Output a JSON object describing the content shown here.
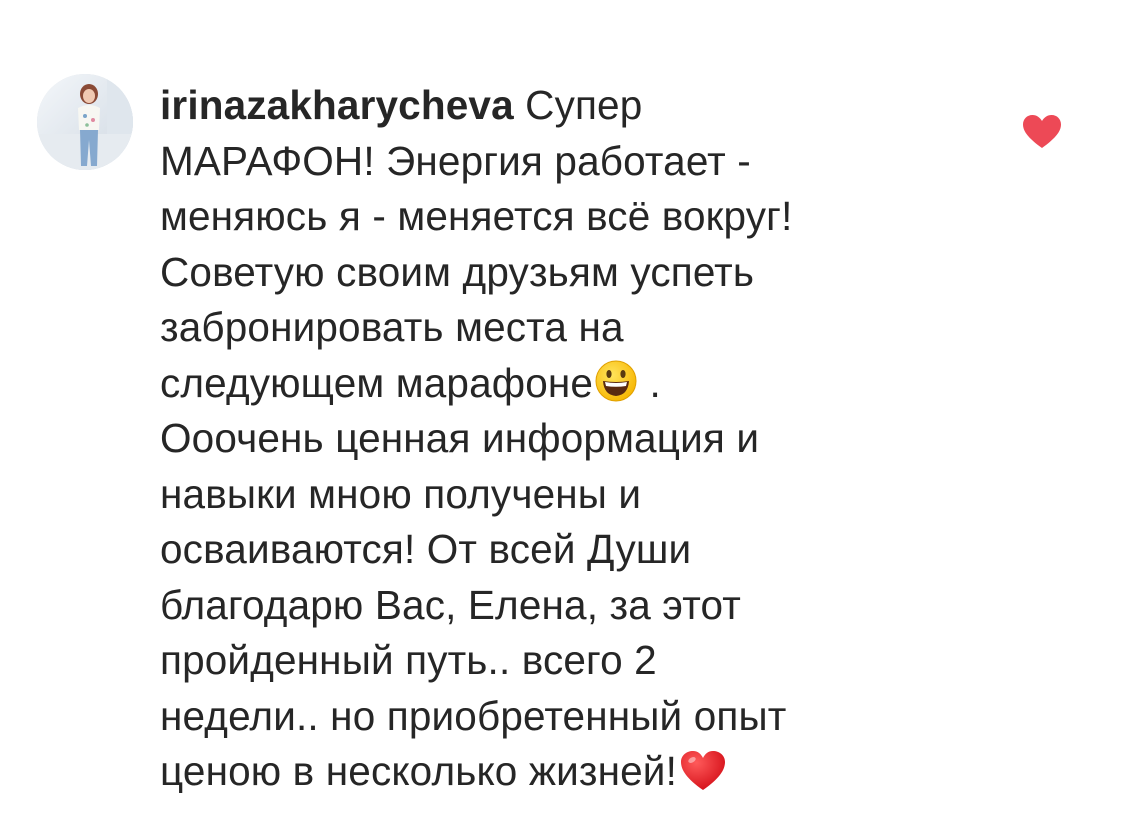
{
  "comment": {
    "username": "irinazakharycheva",
    "lines": [
      " Супер",
      "МАРАФОН! Энергия работает -",
      "меняюсь я - меняется всё вокруг!",
      "Советую своим друзьям успеть",
      "забронировать места на",
      "следующем марафоне",
      "Ооочень ценная информация и",
      "навыки мною получены и",
      "осваиваются! От всей Души",
      "благодарю Вас, Елена, за этот",
      "пройденный путь.. всего 2",
      "недели.. но приобретенный опыт",
      "ценою в несколько жизней!"
    ],
    "after_smiley": " .",
    "emojis": [
      "smiley-face-emoji",
      "red-heart-emoji"
    ]
  },
  "like": {
    "icon": "heart-icon",
    "liked": true,
    "color": "#ed4956"
  },
  "colors": {
    "text": "#262626",
    "like_red": "#ed4956",
    "background": "#ffffff"
  }
}
